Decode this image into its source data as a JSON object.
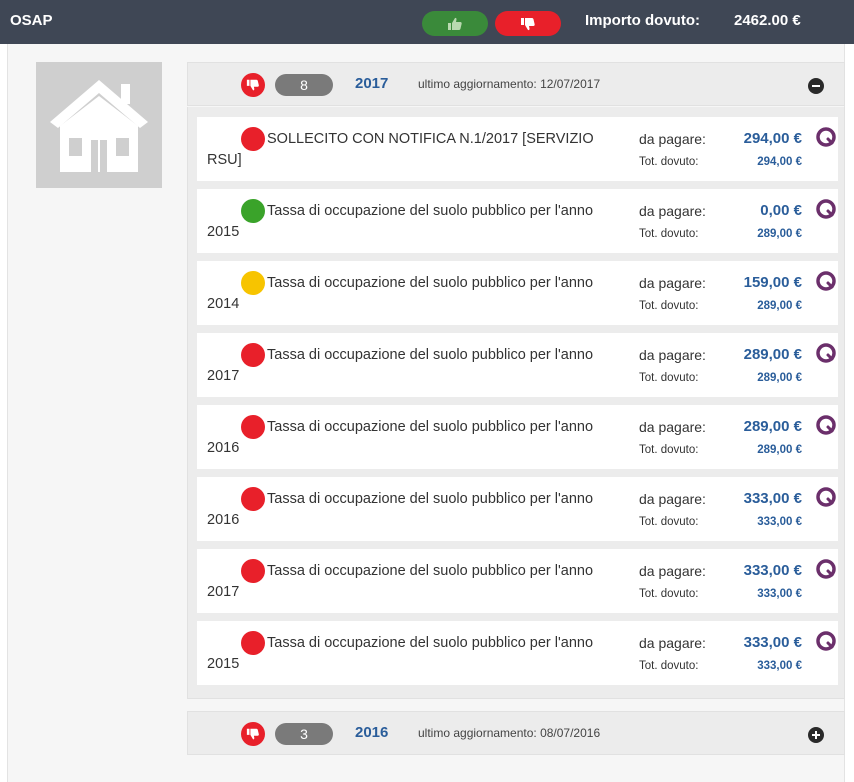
{
  "topbar": {
    "title": "OSAP",
    "importo_label": "Importo dovuto:",
    "importo_value": "2462.00 €"
  },
  "groups": [
    {
      "count": "8",
      "year": "2017",
      "updated": "ultimo aggiornamento: 12/07/2017",
      "expanded": true,
      "items": [
        {
          "status": "red",
          "description": "SOLLECITO CON NOTIFICA N.1/2017 [SERVIZIO RSU]",
          "pay_label": "da pagare:",
          "pay_value": "294,00 €",
          "tot_label": "Tot. dovuto:",
          "tot_value": "294,00 €"
        },
        {
          "status": "green",
          "description": "Tassa di occupazione del suolo pubblico per l'anno 2015",
          "pay_label": "da pagare:",
          "pay_value": "0,00 €",
          "tot_label": "Tot. dovuto:",
          "tot_value": "289,00 €"
        },
        {
          "status": "yellow",
          "description": "Tassa di occupazione del suolo pubblico per l'anno 2014",
          "pay_label": "da pagare:",
          "pay_value": "159,00 €",
          "tot_label": "Tot. dovuto:",
          "tot_value": "289,00 €"
        },
        {
          "status": "red",
          "description": "Tassa di occupazione del suolo pubblico per l'anno 2017",
          "pay_label": "da pagare:",
          "pay_value": "289,00 €",
          "tot_label": "Tot. dovuto:",
          "tot_value": "289,00 €"
        },
        {
          "status": "red",
          "description": "Tassa di occupazione del suolo pubblico per l'anno 2016",
          "pay_label": "da pagare:",
          "pay_value": "289,00 €",
          "tot_label": "Tot. dovuto:",
          "tot_value": "289,00 €"
        },
        {
          "status": "red",
          "description": "Tassa di occupazione del suolo pubblico per l'anno 2016",
          "pay_label": "da pagare:",
          "pay_value": "333,00 €",
          "tot_label": "Tot. dovuto:",
          "tot_value": "333,00 €"
        },
        {
          "status": "red",
          "description": "Tassa di occupazione del suolo pubblico per l'anno 2017",
          "pay_label": "da pagare:",
          "pay_value": "333,00 €",
          "tot_label": "Tot. dovuto:",
          "tot_value": "333,00 €"
        },
        {
          "status": "red",
          "description": "Tassa di occupazione del suolo pubblico per l'anno 2015",
          "pay_label": "da pagare:",
          "pay_value": "333,00 €",
          "tot_label": "Tot. dovuto:",
          "tot_value": "333,00 €"
        }
      ]
    },
    {
      "count": "3",
      "year": "2016",
      "updated": "ultimo aggiornamento: 08/07/2016",
      "expanded": false,
      "items": []
    }
  ],
  "colors": {
    "topbar": "#3f4755",
    "red": "#e8202a",
    "green": "#3aa32a",
    "yellow": "#f7c400",
    "accent": "#2a5d9a",
    "detail_icon": "#6b2f6b"
  },
  "icons": {
    "thumbs_up": "thumbs-up-icon",
    "thumbs_down": "thumbs-down-icon",
    "house": "house-icon",
    "collapse": "minus-circle-icon",
    "expand": "plus-circle-icon",
    "detail": "detail-search-icon"
  }
}
